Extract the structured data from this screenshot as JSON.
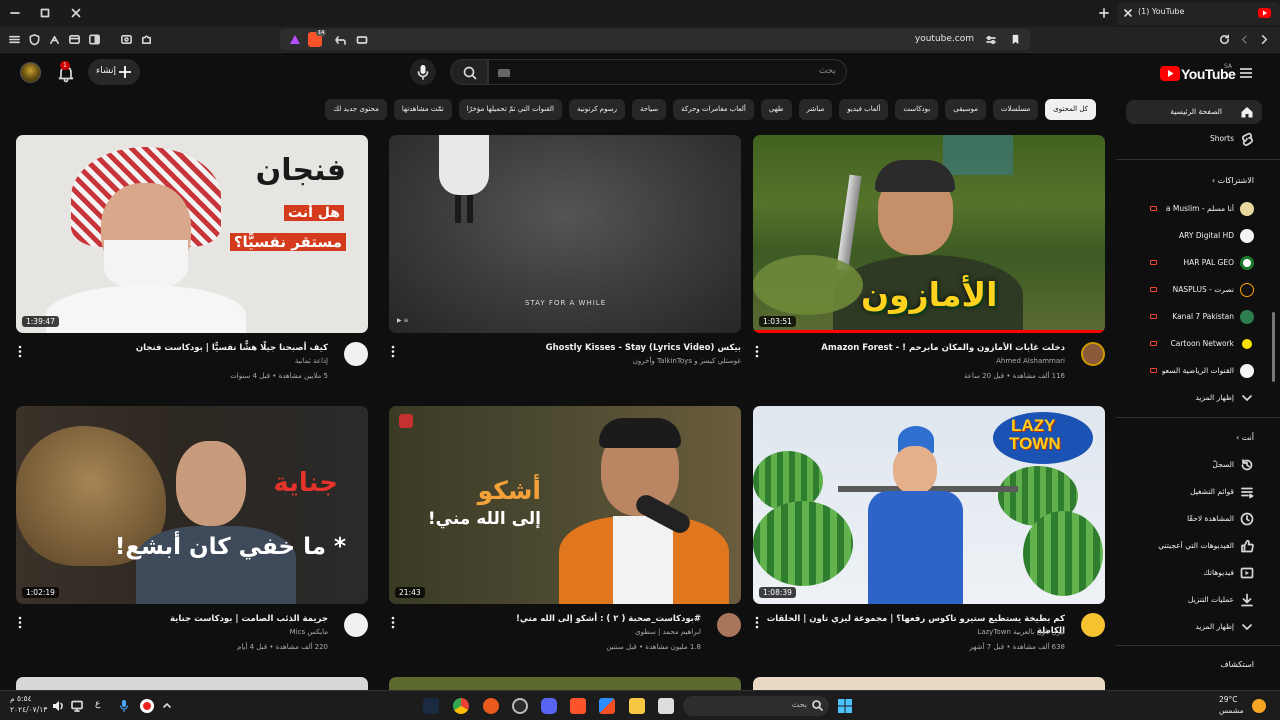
{
  "browser": {
    "tab_title": "(1) YouTube",
    "url": "youtube.com",
    "shield_count": "14"
  },
  "youtube": {
    "logo_text": "YouTube",
    "country_code": "SA",
    "search_placeholder": "بحث",
    "create_label": "إنشاء",
    "notification_count": "1"
  },
  "chips": [
    {
      "label": "كل المحتوى",
      "selected": true
    },
    {
      "label": "مسلسلات"
    },
    {
      "label": "موسيقى"
    },
    {
      "label": "بودكاست"
    },
    {
      "label": "ألعاب فيديو"
    },
    {
      "label": "مباشر"
    },
    {
      "label": "طهي"
    },
    {
      "label": "ألعاب مغامرات وحركة"
    },
    {
      "label": "سياحة"
    },
    {
      "label": "رسوم كرتونية"
    },
    {
      "label": "القنوات التي تمّ تحميلها مؤخرًا"
    },
    {
      "label": "تمّت مشاهدتها"
    },
    {
      "label": "محتوى جديد لك"
    }
  ],
  "sidebar": {
    "home": "الصفحة الرئيسية",
    "shorts": "Shorts",
    "subscriptions_heading": "الاشتراكات",
    "subscriptions": [
      "أنا مسلم - a Muslim",
      "ARY Digital HD",
      "HAR PAL GEO",
      "نصرت - NASPLUS",
      "Kanal 7 Pakistan",
      "Cartoon Network",
      "القنوات الرياضية السعو"
    ],
    "show_more_1": "إظهار المزيد",
    "you_heading": "أنت",
    "you_items": [
      {
        "label": "السجلّ",
        "icon": "history-icon"
      },
      {
        "label": "قوائم التشغيل",
        "icon": "playlists-icon"
      },
      {
        "label": "المشاهدة لاحقًا",
        "icon": "watch-later-icon"
      },
      {
        "label": "الفيديوهات التي أعجبتني",
        "icon": "like-icon"
      },
      {
        "label": "فيديوهاتك",
        "icon": "your-videos-icon"
      },
      {
        "label": "عمليات التنزيل",
        "icon": "download-icon"
      },
      {
        "label": "إظهار المزيد",
        "icon": "chevron-down-icon"
      }
    ],
    "explore_heading": "استكشاف"
  },
  "videos": [
    {
      "title": "دخلت غابات الأمازون والمكان مابرحم ! - Amazon Forest",
      "channel": "Ahmed Alshammari",
      "meta": "116 ألف مشاهدة • قبل 20 ساعة",
      "duration": "1:03:51",
      "overlay": "الأمازون"
    },
    {
      "title": "بيكس Ghostly Kisses - Stay (Lyrics Video)",
      "channel": "غوستلي كيسز و TalkinToys وآخرون",
      "meta": "",
      "duration": "",
      "overlay": "STAY FOR A WHILE"
    },
    {
      "title": "كيف أصبحنا جيلًا هشًّا نفسيًّا | بودكاست فنجان",
      "channel": "إذاعة ثمانية",
      "meta": "5 ملايين مشاهدة • قبل 4 سنوات",
      "duration": "1:39:47",
      "overlay_lines": [
        "فنجان",
        "هل أنت",
        "مستقر نفسيًّا؟"
      ]
    },
    {
      "title": "كم بطيخة يستطيع ستيرو تاكوس رفعها؟ | مجموعة ليزي تاون | الحلقات الكاملة",
      "channel": "ليزي تاون بالعربية LazyTown",
      "meta": "638 ألف مشاهدة • قبل 7 أشهر",
      "duration": "1:08:39",
      "overlay_lines": [
        "LAZY",
        "TOWN"
      ]
    },
    {
      "title": "#بودكاست_صحبة ( ٢ ) : أشكو إلى الله مني!",
      "channel": "ابراهيم محمد | سطوى",
      "meta": "1.8 مليون مشاهدة • قبل سنتين",
      "duration": "21:43",
      "overlay_lines": [
        "أشكو",
        "إلى الله مني!"
      ]
    },
    {
      "title": "جريمة الذئب الصامت | بودكاست جناية",
      "channel": "مايكس Mics",
      "meta": "220 ألف مشاهدة • قبل 4 أيام",
      "duration": "1:02:19",
      "overlay_lines": [
        "جناية",
        "* ما خفي كان أبشع!"
      ]
    }
  ],
  "taskbar": {
    "search_placeholder": "بحث",
    "temperature": "29°C",
    "weather": "مشمس",
    "time": "٥:٥٤ م",
    "date": "٢٠٢٤/٠٧/١٣",
    "lang": "ع"
  }
}
